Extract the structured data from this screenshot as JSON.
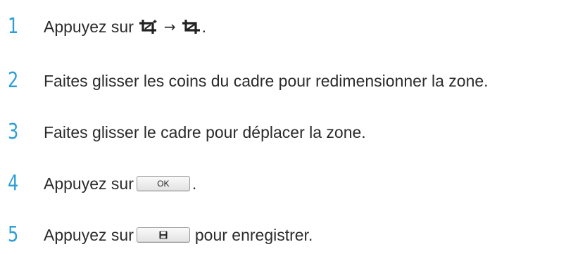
{
  "steps": [
    {
      "number": "1",
      "text_before": "Appuyez sur",
      "icon_a": "crop-tool-icon",
      "arrow": "→",
      "icon_b": "crop-icon",
      "text_after": "."
    },
    {
      "number": "2",
      "text": "Faites glisser les coins du cadre pour redimensionner la zone."
    },
    {
      "number": "3",
      "text": "Faites glisser le cadre pour déplacer la zone."
    },
    {
      "number": "4",
      "text_before": "Appuyez sur",
      "button_label": "OK",
      "text_after": "."
    },
    {
      "number": "5",
      "text_before": "Appuyez sur",
      "button_icon": "save-disk-icon",
      "text_after": "pour enregistrer."
    }
  ],
  "colors": {
    "step_number": "#2e9fd6",
    "body_text": "#2b2b2b"
  }
}
